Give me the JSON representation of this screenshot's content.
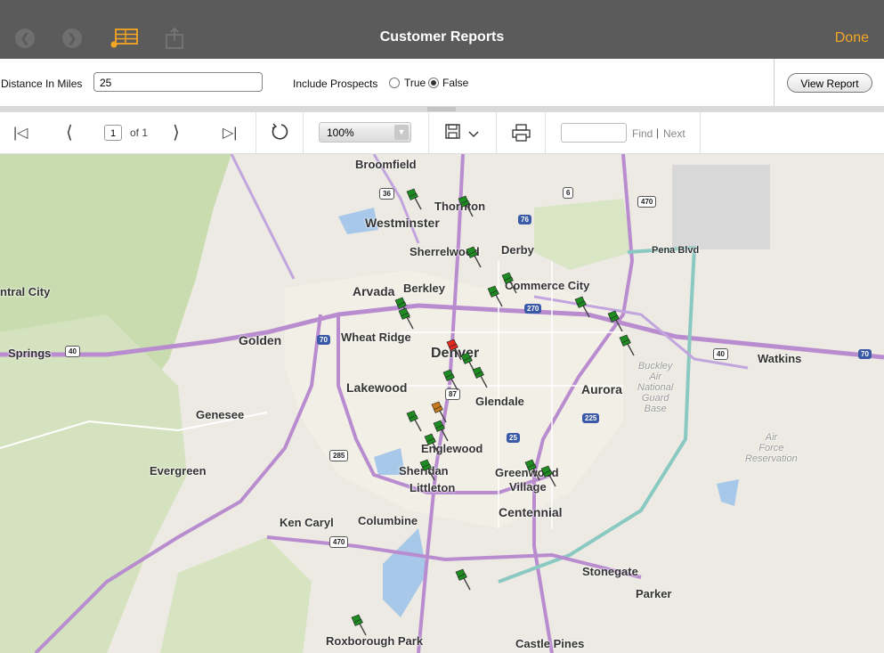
{
  "header": {
    "title": "Customer Reports",
    "done_label": "Done",
    "back_icon": "chevron-left-icon",
    "forward_icon": "chevron-right-icon",
    "report_icon": "report-table-icon",
    "share_icon": "share-icon"
  },
  "parameters": {
    "distance_label": "Distance In Miles",
    "distance_value": "25",
    "prospects_label": "Include Prospects",
    "true_label": "True",
    "false_label": "False",
    "selected": "False",
    "view_report_label": "View Report"
  },
  "toolbar": {
    "page_value": "1",
    "of_label": "of 1",
    "zoom_value": "100%",
    "find_label": "Find",
    "separator": "|",
    "next_label": "Next"
  },
  "map": {
    "places": [
      "Broomfield",
      "Thornton",
      "Westminster",
      "Sherrelwood",
      "Derby",
      "Pena Blvd",
      "Arvada",
      "Berkley",
      "Commerce City",
      "ntral City",
      "Golden",
      "Wheat Ridge",
      "Denver",
      "Springs",
      "Watkins",
      "Lakewood",
      "Glendale",
      "Aurora",
      "Genesee",
      "Englewood",
      "Evergreen",
      "Sheridan",
      "Littleton",
      "Greenwood",
      "Village",
      "Centennial",
      "Ken Caryl",
      "Columbine",
      "Stonegate",
      "Parker",
      "Roxborough Park",
      "Castle Pines"
    ],
    "bases": [
      "Buckley",
      "Air",
      "National",
      "Guard",
      "Base"
    ],
    "air_force": [
      "Air",
      "Force",
      "Reservation"
    ],
    "shields": [
      "36",
      "76",
      "6",
      "470",
      "270",
      "70",
      "40",
      "87",
      "225",
      "25",
      "285"
    ],
    "pin_colors": {
      "customer": "#1e8b22",
      "selected": "#e12b1f",
      "prospect": "#c47a1d"
    }
  }
}
